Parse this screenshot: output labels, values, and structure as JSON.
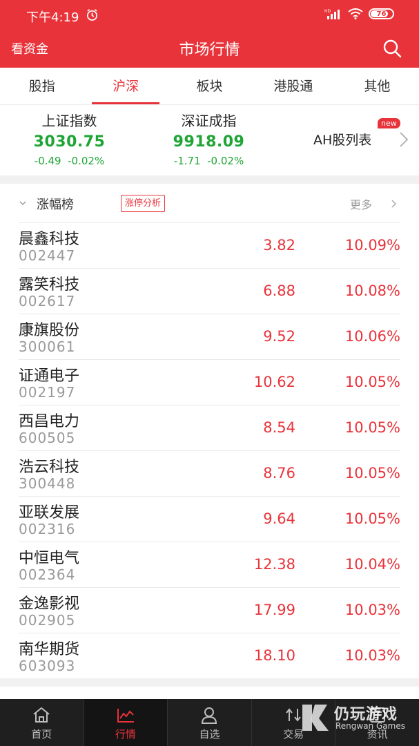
{
  "status_bar": {
    "time": "下午4:19",
    "battery": "76",
    "network": "HD"
  },
  "title_bar": {
    "left_label": "看资金",
    "title": "市场行情"
  },
  "tabs": [
    {
      "label": "股指",
      "active": false
    },
    {
      "label": "沪深",
      "active": true
    },
    {
      "label": "板块",
      "active": false
    },
    {
      "label": "港股通",
      "active": false
    },
    {
      "label": "其他",
      "active": false
    }
  ],
  "indices": [
    {
      "name": "上证指数",
      "value": "3030.75",
      "change": "-0.49",
      "pct": "-0.02%"
    },
    {
      "name": "深证成指",
      "value": "9918.09",
      "change": "-1.71",
      "pct": "-0.02%"
    }
  ],
  "ah_link": {
    "label": "AH股列表",
    "badge": "new"
  },
  "gainers": {
    "title": "涨幅榜",
    "tag": "涨停分析",
    "more": "更多",
    "rows": [
      {
        "name": "晨鑫科技",
        "code": "002447",
        "price": "3.82",
        "pct": "10.09%"
      },
      {
        "name": "露笑科技",
        "code": "002617",
        "price": "6.88",
        "pct": "10.08%"
      },
      {
        "name": "康旗股份",
        "code": "300061",
        "price": "9.52",
        "pct": "10.06%"
      },
      {
        "name": "证通电子",
        "code": "002197",
        "price": "10.62",
        "pct": "10.05%"
      },
      {
        "name": "西昌电力",
        "code": "600505",
        "price": "8.54",
        "pct": "10.05%"
      },
      {
        "name": "浩云科技",
        "code": "300448",
        "price": "8.76",
        "pct": "10.05%"
      },
      {
        "name": "亚联发展",
        "code": "002316",
        "price": "9.64",
        "pct": "10.05%"
      },
      {
        "name": "中恒电气",
        "code": "002364",
        "price": "12.38",
        "pct": "10.04%"
      },
      {
        "name": "金逸影视",
        "code": "002905",
        "price": "17.99",
        "pct": "10.03%"
      },
      {
        "name": "南华期货",
        "code": "603093",
        "price": "18.10",
        "pct": "10.03%"
      }
    ]
  },
  "bottom_nav": [
    {
      "label": "首页",
      "icon": "home-icon",
      "active": false
    },
    {
      "label": "行情",
      "icon": "chart-icon",
      "active": true
    },
    {
      "label": "自选",
      "icon": "user-icon",
      "active": false
    },
    {
      "label": "交易",
      "icon": "trade-icon",
      "active": false
    },
    {
      "label": "资讯",
      "icon": "news-icon",
      "active": false
    }
  ],
  "watermark": {
    "text": "仍玩游戏",
    "sub": "Rengwan Games"
  },
  "colors": {
    "brand_red": "#e8333a",
    "down_green": "#1ea535",
    "nav_bg": "#1f1f1f"
  }
}
